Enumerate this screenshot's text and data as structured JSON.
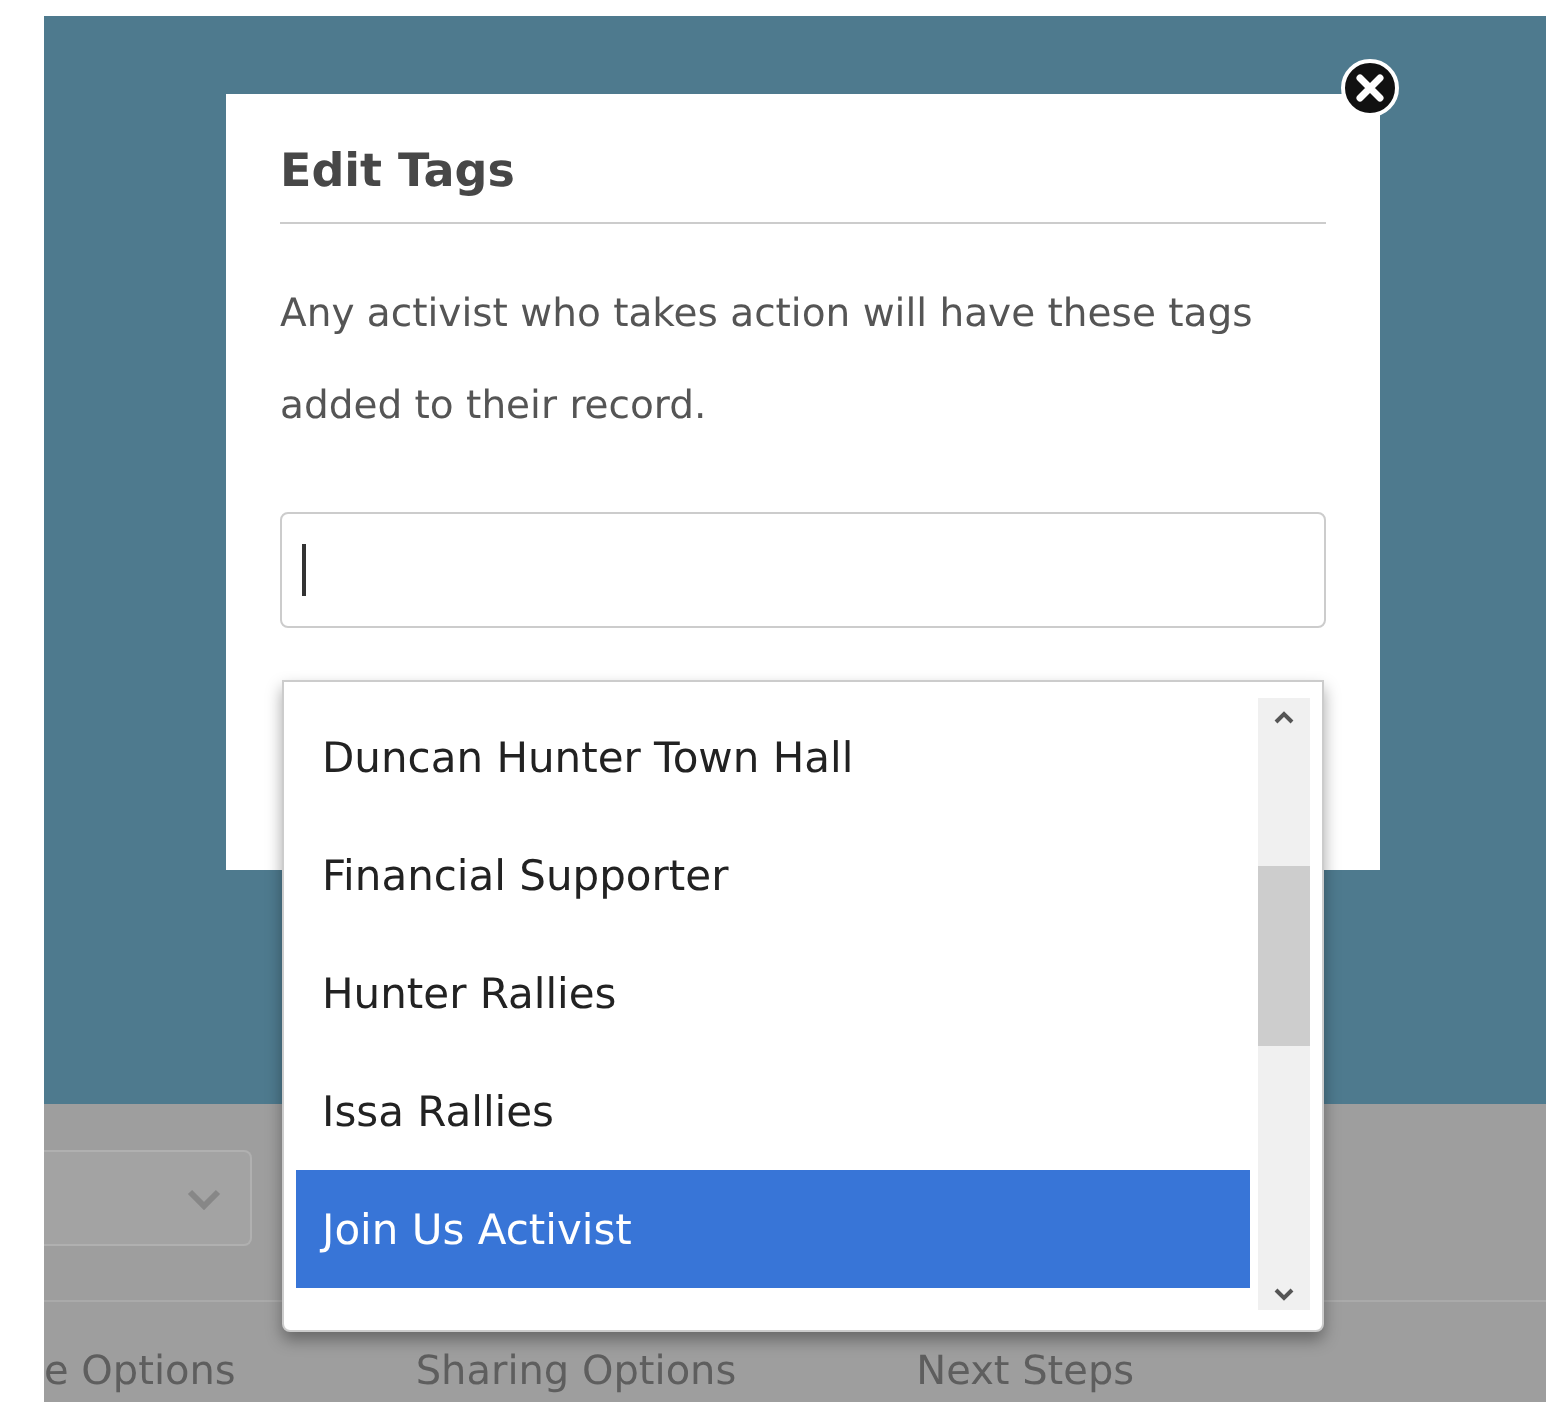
{
  "background": {
    "tabs": [
      {
        "label": "e Options"
      },
      {
        "label": "Sharing Options"
      },
      {
        "label": "Next Steps"
      }
    ]
  },
  "modal": {
    "title": "Edit Tags",
    "description": "Any activist who takes action will have these tags added to their record.",
    "tag_input": {
      "focused": true
    },
    "options": [
      {
        "label": "Duncan Hunter Town Hall",
        "selected": false
      },
      {
        "label": "Financial Supporter",
        "selected": false
      },
      {
        "label": "Hunter Rallies",
        "selected": false
      },
      {
        "label": "Issa Rallies",
        "selected": false
      },
      {
        "label": "Join Us Activist",
        "selected": true
      }
    ]
  }
}
